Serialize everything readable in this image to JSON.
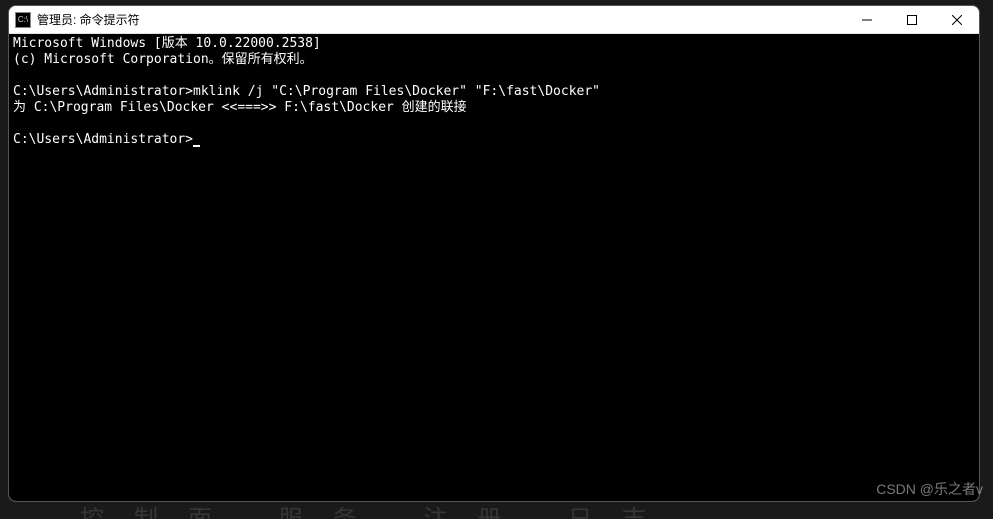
{
  "window": {
    "icon_label": "C:\\",
    "title": "管理员: 命令提示符"
  },
  "terminal": {
    "lines": [
      "Microsoft Windows [版本 10.0.22000.2538]",
      "(c) Microsoft Corporation。保留所有权利。",
      "",
      "C:\\Users\\Administrator>mklink /j \"C:\\Program Files\\Docker\" \"F:\\fast\\Docker\"",
      "为 C:\\Program Files\\Docker <<===>> F:\\fast\\Docker 创建的联接",
      "",
      "C:\\Users\\Administrator>"
    ]
  },
  "watermark": "CSDN @乐之者v"
}
